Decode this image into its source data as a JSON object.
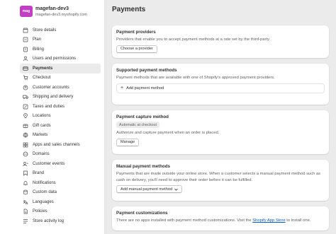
{
  "store": {
    "logo_text": "mag",
    "name": "magefan-dev3",
    "url": "magefan-dev3.myshopify.com",
    "logo_color": "#c23ec2"
  },
  "sidebar": {
    "items": [
      {
        "label": "Store details",
        "icon": "store-icon"
      },
      {
        "label": "Plan",
        "icon": "plan-icon"
      },
      {
        "label": "Billing",
        "icon": "billing-icon"
      },
      {
        "label": "Users and permissions",
        "icon": "users-icon"
      },
      {
        "label": "Payments",
        "icon": "payments-icon",
        "active": true
      },
      {
        "label": "Checkout",
        "icon": "checkout-icon"
      },
      {
        "label": "Customer accounts",
        "icon": "customer-accounts-icon"
      },
      {
        "label": "Shipping and delivery",
        "icon": "shipping-icon"
      },
      {
        "label": "Taxes and duties",
        "icon": "taxes-icon"
      },
      {
        "label": "Locations",
        "icon": "location-icon"
      },
      {
        "label": "Gift cards",
        "icon": "gift-card-icon"
      },
      {
        "label": "Markets",
        "icon": "markets-icon"
      },
      {
        "label": "Apps and sales channels",
        "icon": "apps-icon"
      },
      {
        "label": "Domains",
        "icon": "domains-icon"
      },
      {
        "label": "Customer events",
        "icon": "customer-events-icon"
      },
      {
        "label": "Brand",
        "icon": "brand-icon"
      },
      {
        "label": "Notifications",
        "icon": "notifications-icon"
      },
      {
        "label": "Custom data",
        "icon": "custom-data-icon"
      },
      {
        "label": "Languages",
        "icon": "languages-icon"
      },
      {
        "label": "Policies",
        "icon": "policies-icon"
      },
      {
        "label": "Store activity log",
        "icon": "activity-log-icon"
      }
    ]
  },
  "main": {
    "title": "Payments",
    "providers": {
      "title": "Payment providers",
      "text": "Providers that enable you to accept payment methods at a rate set by the third-party.",
      "button": "Choose a provider"
    },
    "supported": {
      "title": "Supported payment methods",
      "text": "Payment methods that are available with one of Shopify's approved payment providers.",
      "add_label": "Add payment method"
    },
    "capture": {
      "title": "Payment capture method",
      "badge": "Automatic at checkout",
      "text": "Authorize and capture payment when an order is placed.",
      "button": "Manage"
    },
    "manual": {
      "title": "Manual payment methods",
      "text": "Payments that are made outside your online store. When a customer selects a manual payment method such as cash on delivery, you'll need to approve their order before it can be fulfilled.",
      "button": "Add manual payment method"
    },
    "customizations": {
      "title": "Payment customizations",
      "text_before": "There are no apps installed with payment method customizations. Visit the ",
      "link": "Shopify App Store",
      "text_after": " to install one."
    }
  }
}
